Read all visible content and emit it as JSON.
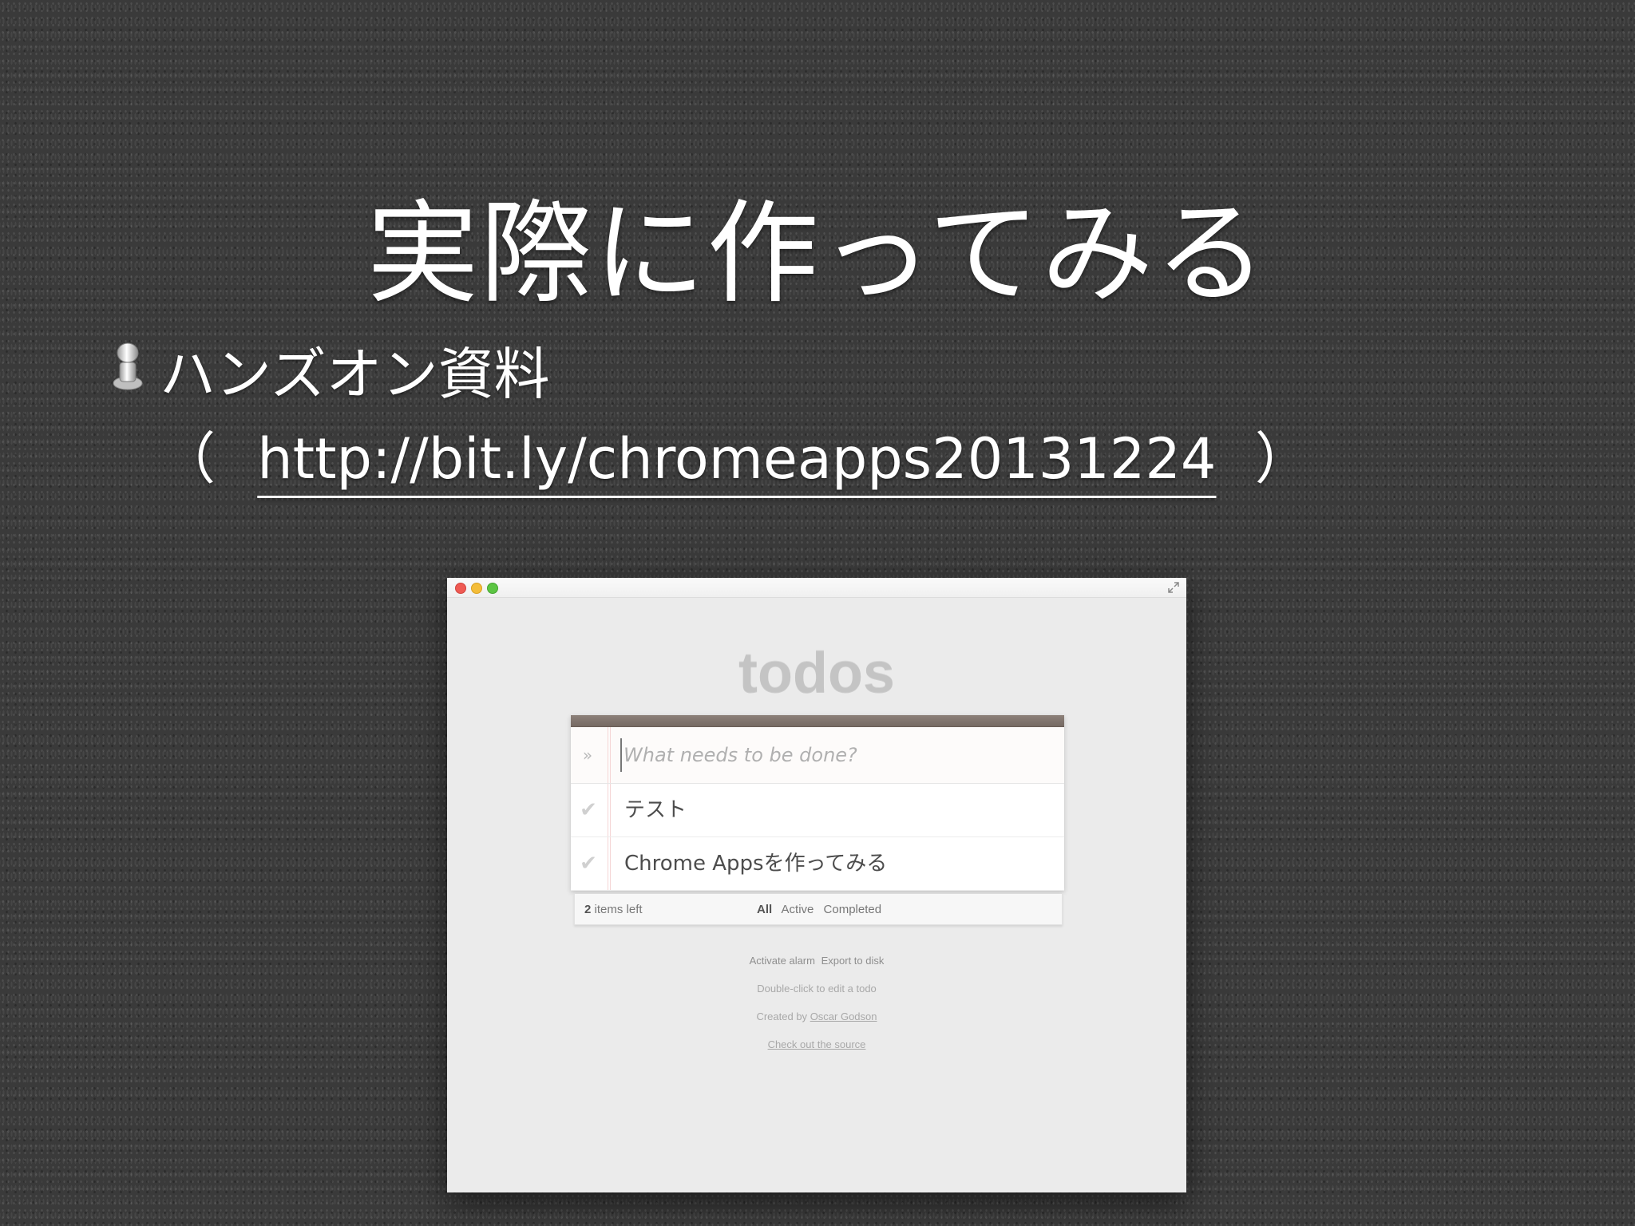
{
  "slide": {
    "title": "実際に作ってみる",
    "bullet": "ハンズオン資料",
    "link_open": "（",
    "link_url": "http://bit.ly/chromeapps20131224",
    "link_close": "）"
  },
  "app": {
    "heading": "todos",
    "new_todo_placeholder": "What needs to be done?",
    "todos": [
      {
        "label": "テスト"
      },
      {
        "label": "Chrome Appsを作ってみる"
      }
    ],
    "footer": {
      "count": "2",
      "count_suffix": "items left",
      "filters": [
        "All",
        "Active",
        "Completed"
      ]
    },
    "actions": [
      "Activate alarm",
      "Export to disk"
    ],
    "hint": "Double-click to edit a todo",
    "credit_prefix": "Created by",
    "credit_author": "Oscar Godson",
    "source_link": "Check out the source"
  },
  "icons": {
    "pin": "pushpin-icon",
    "toggle_all": "double-chevron-down-icon",
    "check": "checkmark-icon",
    "fullscreen": "fullscreen-icon"
  },
  "colors": {
    "background": "#3a3a3a",
    "panel_header": "#7e7269",
    "close": "#ef5a53",
    "minimize": "#f4bd39",
    "maximize": "#5cc543"
  }
}
